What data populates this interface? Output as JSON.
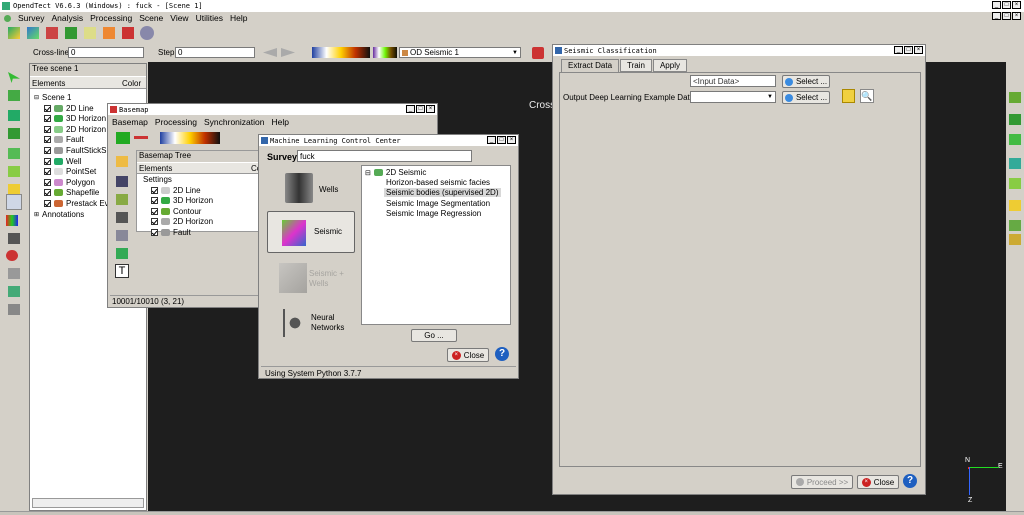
{
  "main_window": {
    "title": "OpendTect V6.6.3 (Windows) : fuck - [Scene 1]",
    "menu": [
      "Survey",
      "Analysis",
      "Processing",
      "Scene",
      "View",
      "Utilities",
      "Help"
    ]
  },
  "toolbar": {
    "crossline_label": "Cross-line",
    "crossline_value": "0",
    "step_label": "Step",
    "step_value": "0",
    "seismic_label": "OD Seismic 1"
  },
  "tree_scene": {
    "title": "Tree scene 1",
    "col_elements": "Elements",
    "col_color": "Color",
    "items": [
      "Scene 1",
      "2D Line",
      "3D Horizon",
      "2D Horizon",
      "Fault",
      "FaultStickS",
      "Well",
      "PointSet",
      "Polygon",
      "Shapefile",
      "Prestack Ev",
      "Annotations"
    ]
  },
  "scene_label": "Cross",
  "basemap": {
    "title": "Basemap",
    "menu": [
      "Basemap",
      "Processing",
      "Synchronization",
      "Help"
    ],
    "tree_title": "Basemap Tree",
    "col_elements": "Elements",
    "col_co": "Co",
    "items": [
      "Settings",
      "2D Line",
      "3D Horizon",
      "Contour",
      "2D Horizon",
      "Fault"
    ],
    "status": "10001/10010 (3, 21)"
  },
  "mlc": {
    "title": "Machine Learning Control Center",
    "survey_label": "Survey",
    "survey_value": "fuck",
    "side_buttons": [
      "Wells",
      "Seismic",
      "Seismic + Wells",
      "Neural Networks"
    ],
    "tree_root": "2D Seismic",
    "tree_items": [
      "Horizon-based seismic facies",
      "Seismic bodies (supervised 2D)",
      "Seismic Image Segmentation",
      "Seismic Image Regression"
    ],
    "go_label": "Go ...",
    "close_label": "Close",
    "status": "Using System Python 3.7.7"
  },
  "seis_class": {
    "title": "Seismic Classification",
    "tabs": [
      "Extract Data",
      "Train",
      "Apply"
    ],
    "input_placeholder": "<Input Data>",
    "select_label": "Select ...",
    "output_label": "Output Deep Learning Example Data",
    "proceed_label": "Proceed >>",
    "close_label": "Close"
  },
  "axes": {
    "n": "N",
    "e": "E",
    "z": "Z"
  },
  "colors": {
    "accent": "#316ac5",
    "scene_bg": "#1e1e1e",
    "close_red": "#cc2222"
  }
}
